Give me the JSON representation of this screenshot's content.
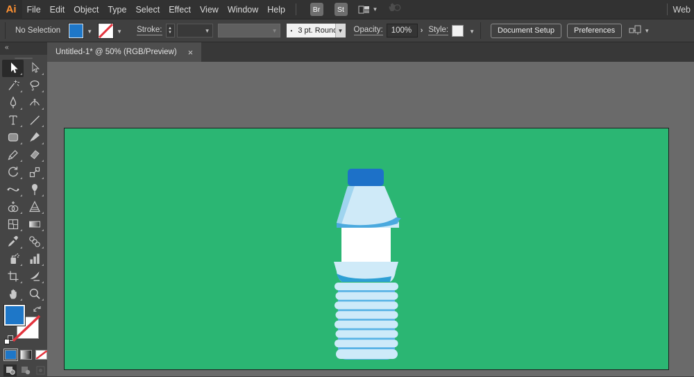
{
  "menubar": {
    "logo": "Ai",
    "items": [
      "File",
      "Edit",
      "Object",
      "Type",
      "Select",
      "Effect",
      "View",
      "Window",
      "Help"
    ],
    "br": "Br",
    "st": "St",
    "workspace": "Web"
  },
  "controlbar": {
    "no_selection": "No Selection",
    "fill_color": "#1e77c8",
    "stroke_label": "Stroke:",
    "bullet": "•",
    "brush_style": "3 pt. Round",
    "opacity_label": "Opacity:",
    "opacity_value": "100%",
    "style_label": "Style:",
    "document_setup": "Document Setup",
    "preferences": "Preferences"
  },
  "tabbar": {
    "title": "Untitled-1* @ 50% (RGB/Preview)",
    "close": "×"
  },
  "toolbar": {
    "collapse": "«",
    "fill_color": "#1e77c8",
    "tools": [
      {
        "name": "selection",
        "active": true
      },
      {
        "name": "direct-selection"
      },
      {
        "name": "magic-wand"
      },
      {
        "name": "lasso"
      },
      {
        "name": "pen"
      },
      {
        "name": "curvature"
      },
      {
        "name": "type"
      },
      {
        "name": "line-segment"
      },
      {
        "name": "rectangle"
      },
      {
        "name": "paintbrush"
      },
      {
        "name": "pencil"
      },
      {
        "name": "eraser"
      },
      {
        "name": "rotate"
      },
      {
        "name": "scale"
      },
      {
        "name": "width"
      },
      {
        "name": "puppet-warp"
      },
      {
        "name": "shape-builder"
      },
      {
        "name": "perspective-grid"
      },
      {
        "name": "mesh"
      },
      {
        "name": "gradient"
      },
      {
        "name": "eyedropper"
      },
      {
        "name": "blend"
      },
      {
        "name": "symbol-sprayer"
      },
      {
        "name": "column-graph"
      },
      {
        "name": "artboard"
      },
      {
        "name": "slice"
      },
      {
        "name": "hand"
      },
      {
        "name": "zoom"
      }
    ]
  },
  "canvas": {
    "artboard_color": "#2bb673"
  },
  "bottle": {
    "cap": "#1d71c8",
    "body": "#cfeaf8",
    "shade": "#9fd4ef",
    "swoosh": "#4aa9de",
    "deep": "#2d9fd4",
    "ridge_back": "#58b3e5",
    "ridge": "#cdeaf9",
    "label": "#ffffff"
  }
}
